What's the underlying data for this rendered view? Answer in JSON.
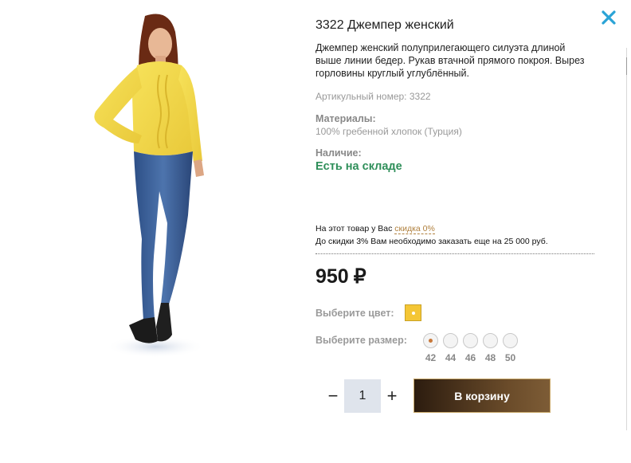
{
  "product": {
    "title": "3322 Джемпер женский",
    "description": "Джемпер женский полуприлегающего силуэта длиной выше линии бедер. Рукав втачной прямого покроя. Вырез горловины круглый углублённый.",
    "article": "Артикульный номер: 3322",
    "materials_label": "Материалы:",
    "materials_value": "100% гребенной хлопок (Турция)",
    "availability_label": "Наличие:",
    "availability_value": "Есть на складе"
  },
  "discount": {
    "line1_prefix": "На этот товар у Вас ",
    "line1_link": "скидка 0%",
    "line2": "До скидки 3% Вам необходимо заказать еще на 25 000 руб."
  },
  "price": {
    "amount": "950",
    "currency": "₽"
  },
  "color": {
    "label": "Выберите цвет:",
    "selected_hex": "#f4c635"
  },
  "size": {
    "label": "Выберите размер:",
    "options": [
      "42",
      "44",
      "46",
      "48",
      "50"
    ],
    "selected": "42"
  },
  "quantity": {
    "minus": "−",
    "value": "1",
    "plus": "+"
  },
  "cart_button": "В корзину",
  "icons": {
    "close": "close-icon"
  },
  "colors": {
    "accent_close": "#2aa3d6",
    "in_stock": "#2f8f5a",
    "discount_link": "#b0803e"
  }
}
